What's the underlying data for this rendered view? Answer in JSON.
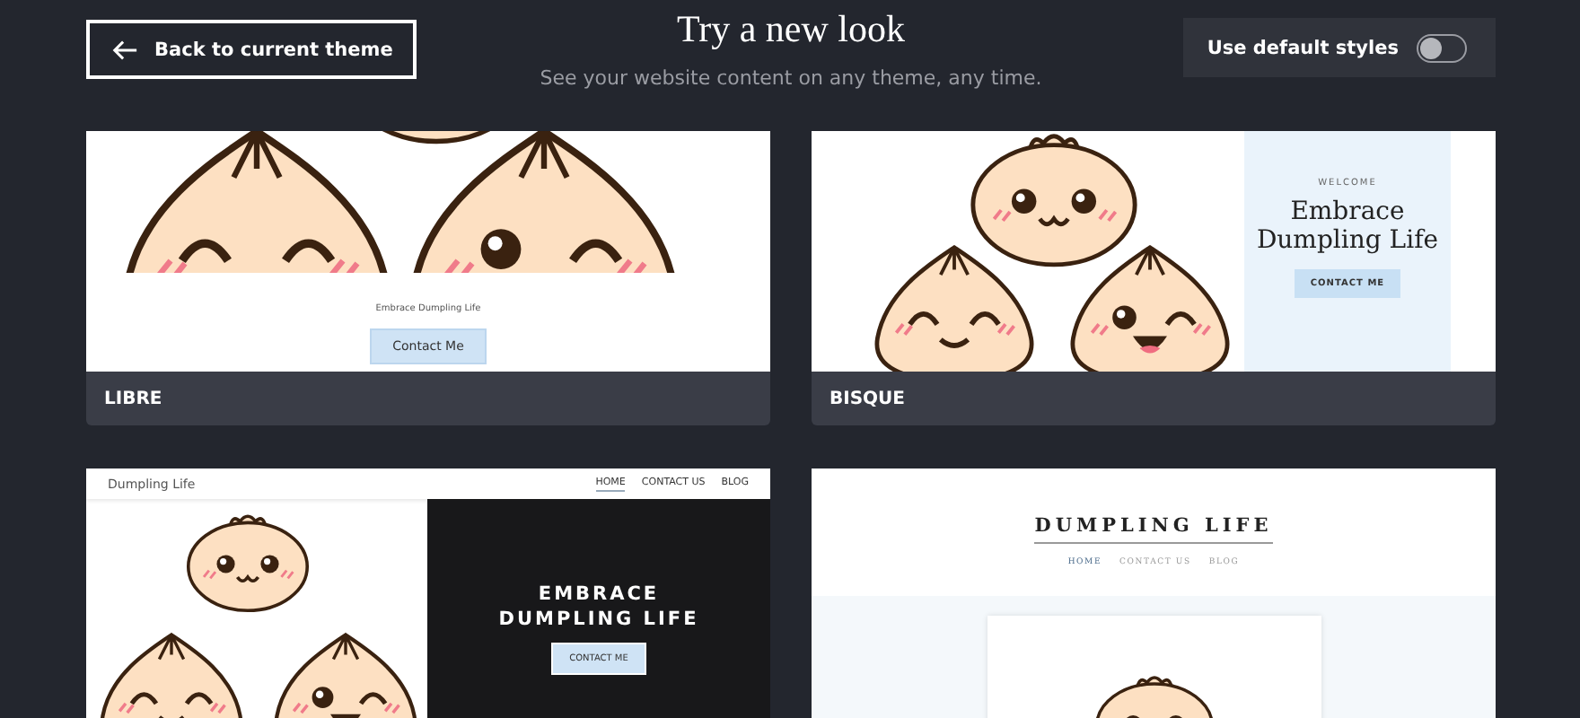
{
  "header": {
    "back_button": "Back to current theme",
    "title": "Try a new look",
    "subtitle": "See your website content on any theme, any time.",
    "default_styles": {
      "label": "Use default styles",
      "on": false
    }
  },
  "themes": [
    {
      "kind": "libre",
      "name": "LIBRE",
      "preview": {
        "tagline": "Embrace Dumpling Life",
        "button": "Contact Me"
      }
    },
    {
      "kind": "bisque",
      "name": "BISQUE",
      "preview": {
        "eyebrow": "WELCOME",
        "heading": "Embrace Dumpling Life",
        "button": "CONTACT ME"
      }
    },
    {
      "kind": "split",
      "preview": {
        "logo": "Dumpling Life",
        "nav": [
          {
            "label": "HOME",
            "selected": true
          },
          {
            "label": "CONTACT US",
            "selected": false
          },
          {
            "label": "BLOG",
            "selected": false
          }
        ],
        "heading": "EMBRACE DUMPLING LIFE",
        "button": "CONTACT ME"
      }
    },
    {
      "kind": "classic",
      "preview": {
        "logo": "DUMPLING LIFE",
        "nav": [
          {
            "label": "HOME",
            "selected": true
          },
          {
            "label": "CONTACT US",
            "selected": false
          },
          {
            "label": "BLOG",
            "selected": false
          }
        ]
      }
    }
  ]
}
